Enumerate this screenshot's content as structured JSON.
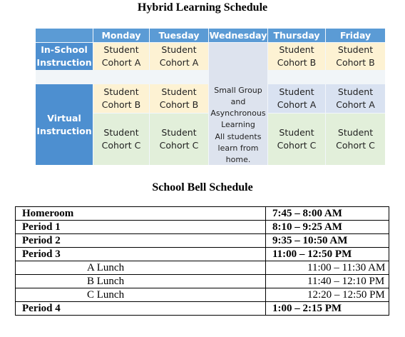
{
  "hybrid": {
    "title": "Hybrid Learning Schedule",
    "days": [
      "Monday",
      "Tuesday",
      "Wednesday",
      "Thursday",
      "Friday"
    ],
    "in_school_label": "In-School Instruction",
    "virtual_label": "Virtual Instruction",
    "in_school": {
      "monday": "Student Cohort A",
      "tuesday": "Student Cohort A",
      "thursday": "Student Cohort B",
      "friday": "Student Cohort B"
    },
    "virtual_row1": {
      "monday": "Student Cohort B",
      "tuesday": "Student Cohort B",
      "thursday": "Student Cohort A",
      "friday": "Student Cohort A"
    },
    "virtual_row2": {
      "monday": "Student Cohort C",
      "tuesday": "Student Cohort  C",
      "thursday": "Student Cohort C",
      "friday": "Student Cohort C"
    },
    "wednesday_top": "Small Group and Asynchronous Learning",
    "wednesday_bottom": "All students learn from home."
  },
  "bell": {
    "title": "School Bell Schedule",
    "rows": [
      {
        "name": "Homeroom",
        "time": "7:45 – 8:00 AM"
      },
      {
        "name": "Period 1",
        "time": "8:10 – 9:25 AM"
      },
      {
        "name": "Period 2",
        "time": "9:35 – 10:50 AM"
      },
      {
        "name": "Period 3",
        "time": "11:00 – 12:50 PM"
      },
      {
        "name": "A Lunch",
        "time": "11:00 – 11:30 AM"
      },
      {
        "name": "B Lunch",
        "time": "11:40 – 12:10 PM"
      },
      {
        "name": "C Lunch",
        "time": "12:20 – 12:50 PM"
      },
      {
        "name": "Period 4",
        "time": "1:00 – 2:15 PM"
      }
    ]
  }
}
